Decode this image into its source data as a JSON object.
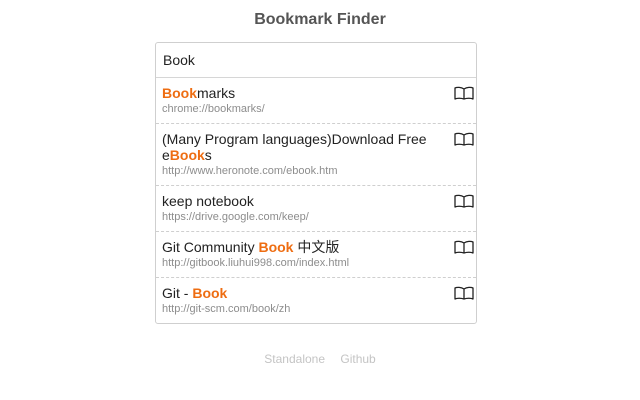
{
  "app": {
    "title": "Bookmark Finder"
  },
  "search": {
    "value": "Book",
    "highlight": "Book"
  },
  "icons": {
    "result_icon": "open-book-icon"
  },
  "colors": {
    "highlight": "#ee6d12",
    "url": "#8d8d8d"
  },
  "results": [
    {
      "title_parts": [
        {
          "text": "Book",
          "hl": true
        },
        {
          "text": "marks",
          "hl": false
        }
      ],
      "url": "chrome://bookmarks/"
    },
    {
      "title_parts": [
        {
          "text": "(Many Program languages)Download Free e",
          "hl": false
        },
        {
          "text": "Book",
          "hl": true
        },
        {
          "text": "s",
          "hl": false
        }
      ],
      "url": "http://www.heronote.com/ebook.htm"
    },
    {
      "title_parts": [
        {
          "text": "keep notebook",
          "hl": false
        }
      ],
      "url": "https://drive.google.com/keep/"
    },
    {
      "title_parts": [
        {
          "text": "Git Community ",
          "hl": false
        },
        {
          "text": "Book",
          "hl": true
        },
        {
          "text": " 中文版",
          "hl": false
        }
      ],
      "url": "http://gitbook.liuhui998.com/index.html"
    },
    {
      "title_parts": [
        {
          "text": "Git - ",
          "hl": false
        },
        {
          "text": "Book",
          "hl": true
        }
      ],
      "url": "http://git-scm.com/book/zh"
    }
  ],
  "footer": {
    "links": [
      "Standalone",
      "Github"
    ]
  }
}
